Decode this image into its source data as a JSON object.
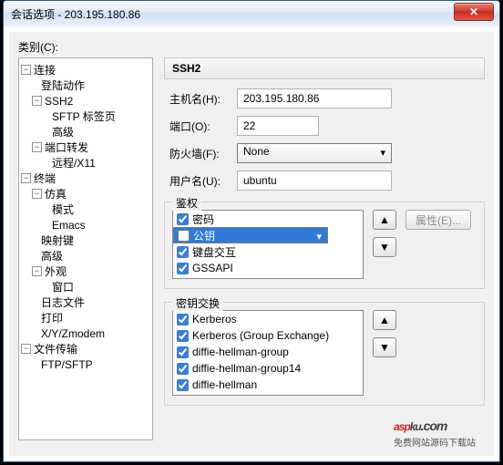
{
  "window": {
    "title": "会话选项 - 203.195.180.86"
  },
  "category_label": "类别(C):",
  "tree": {
    "connection": "连接",
    "login_actions": "登陆动作",
    "ssh2": "SSH2",
    "sftp_tab": "SFTP 标签页",
    "advanced1": "高级",
    "port_fwd": "端口转发",
    "remote_x11": "远程/X11",
    "terminal": "终端",
    "emulation": "仿真",
    "modes": "模式",
    "emacs": "Emacs",
    "map_keys": "映射键",
    "advanced2": "高级",
    "appearance": "外观",
    "window_item": "窗口",
    "log_file": "日志文件",
    "print": "打印",
    "xyz": "X/Y/Zmodem",
    "file_transfer": "文件传输",
    "ftpsftp": "FTP/SFTP"
  },
  "panel": {
    "title": "SSH2",
    "host_label": "主机名(H):",
    "host_value": "203.195.180.86",
    "port_label": "端口(O):",
    "port_value": "22",
    "fw_label": "防火墙(F):",
    "fw_value": "None",
    "user_label": "用户名(U):",
    "user_value": "ubuntu"
  },
  "auth": {
    "legend": "鉴权",
    "items": [
      {
        "label": "密码",
        "checked": true,
        "selected": false
      },
      {
        "label": "公钥",
        "checked": false,
        "selected": true
      },
      {
        "label": "键盘交互",
        "checked": true,
        "selected": false
      },
      {
        "label": "GSSAPI",
        "checked": true,
        "selected": false
      }
    ],
    "props_btn": "属性(E)..."
  },
  "kex": {
    "legend": "密钥交换",
    "items": [
      {
        "label": "Kerberos",
        "checked": true
      },
      {
        "label": "Kerberos (Group Exchange)",
        "checked": true
      },
      {
        "label": "diffie-hellman-group",
        "checked": true
      },
      {
        "label": "diffie-hellman-group14",
        "checked": true
      },
      {
        "label": "diffie-hellman",
        "checked": true
      }
    ]
  },
  "watermark": {
    "brand_a": "asp",
    "brand_b": "ku",
    "suffix": ".com",
    "sub": "免费网站源码下载站"
  }
}
